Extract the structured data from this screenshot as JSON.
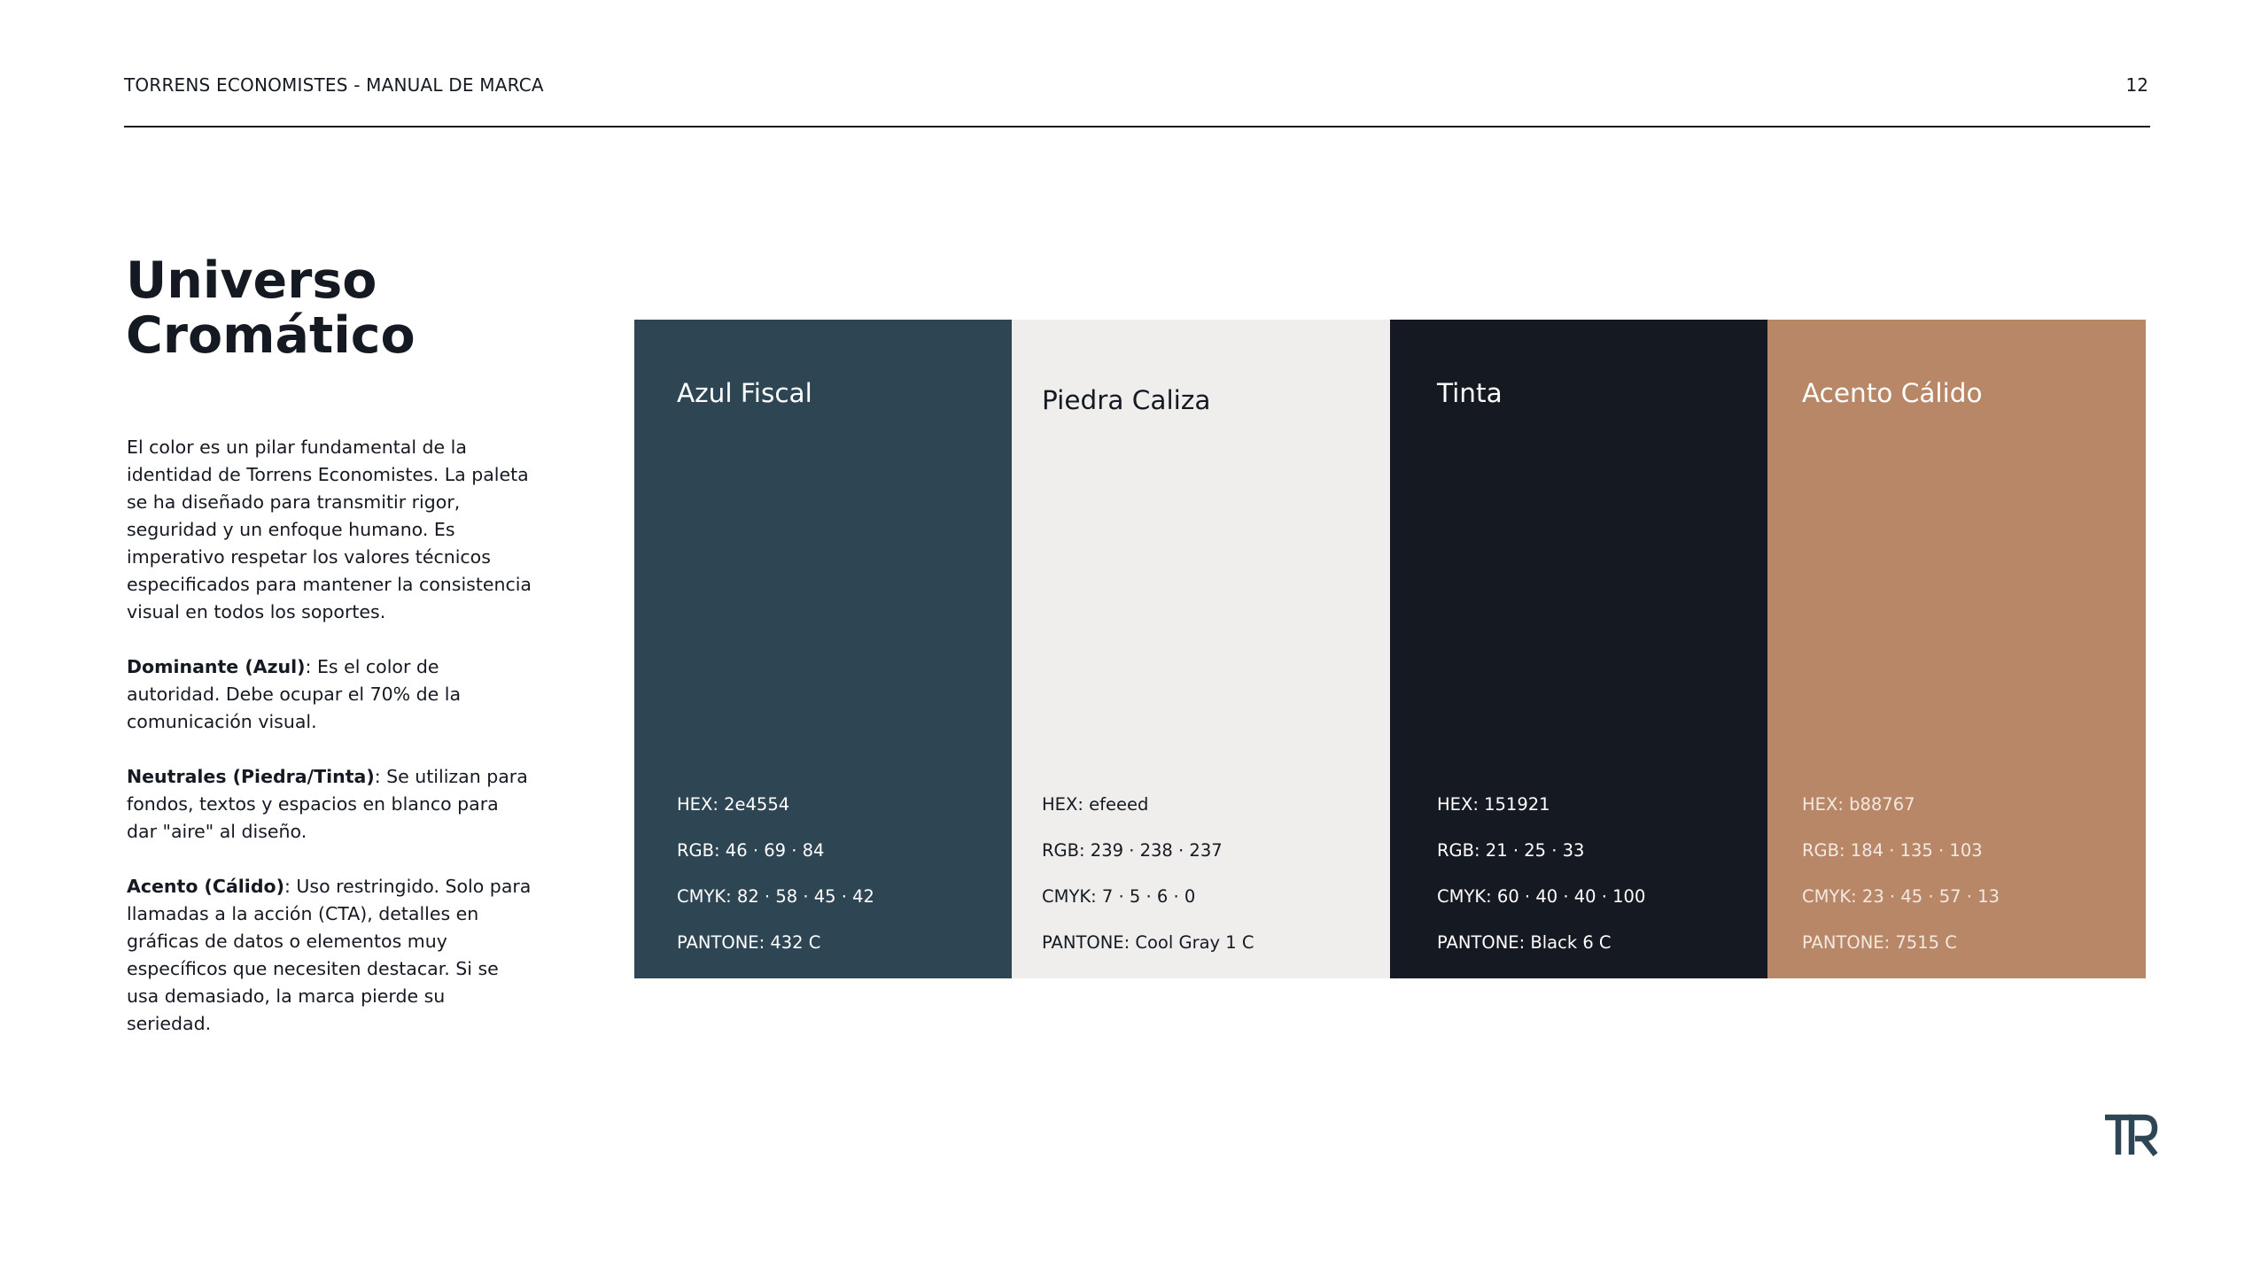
{
  "header": {
    "title": "TORRENS ECONOMISTES - MANUAL DE MARCA",
    "page_number": "12"
  },
  "heading": {
    "line1": "Universo",
    "line2": "Cromático"
  },
  "intro": {
    "paragraph": "El color es un pilar fundamental de la identidad de Torrens Economistes. La paleta se ha diseñado para transmitir rigor, seguridad y un enfoque humano. Es imperativo respetar los valores técnicos especificados para mantener la consistencia visual en todos los soportes.",
    "notes": [
      {
        "label": "Dominante (Azul)",
        "text": ": Es el color de autoridad. Debe ocupar el 70% de la comunicación visual."
      },
      {
        "label": "Neutrales (Piedra/Tinta)",
        "text": ": Se utilizan para fondos, textos y espacios en blanco para dar \"aire\" al diseño."
      },
      {
        "label": "Acento (Cálido)",
        "text": ": Uso restringido. Solo para llamadas a la acción (CTA), detalles en gráficas de datos o elementos muy específicos que necesiten destacar. Si se usa demasiado, la marca pierde su seriedad."
      }
    ]
  },
  "palette": [
    {
      "name": "Azul Fiscal",
      "hex": "HEX: 2e4554",
      "rgb": "RGB: 46 · 69 · 84",
      "cmyk": "CMYK: 82 · 58 · 45 · 42",
      "pantone": "PANTONE: 432 C",
      "color": "#2e4554"
    },
    {
      "name": "Piedra Caliza",
      "hex": "HEX: efeeed",
      "rgb": "RGB: 239 · 238 · 237",
      "cmyk": "CMYK: 7 · 5 · 6 · 0",
      "pantone": "PANTONE: Cool Gray 1 C",
      "color": "#efeeed"
    },
    {
      "name": "Tinta",
      "hex": "HEX: 151921",
      "rgb": "RGB: 21 · 25 · 33",
      "cmyk": "CMYK: 60 · 40 · 40 · 100",
      "pantone": "PANTONE: Black 6 C",
      "color": "#151921"
    },
    {
      "name": "Acento Cálido",
      "hex": "HEX: b88767",
      "rgb": "RGB: 184 · 135 · 103",
      "cmyk": "CMYK: 23 · 45 · 57 · 13",
      "pantone": "PANTONE: 7515 C",
      "color": "#b88767"
    }
  ],
  "logo": {
    "icon": "tr-monogram-logo",
    "text": "TR",
    "color": "#2e4554"
  }
}
